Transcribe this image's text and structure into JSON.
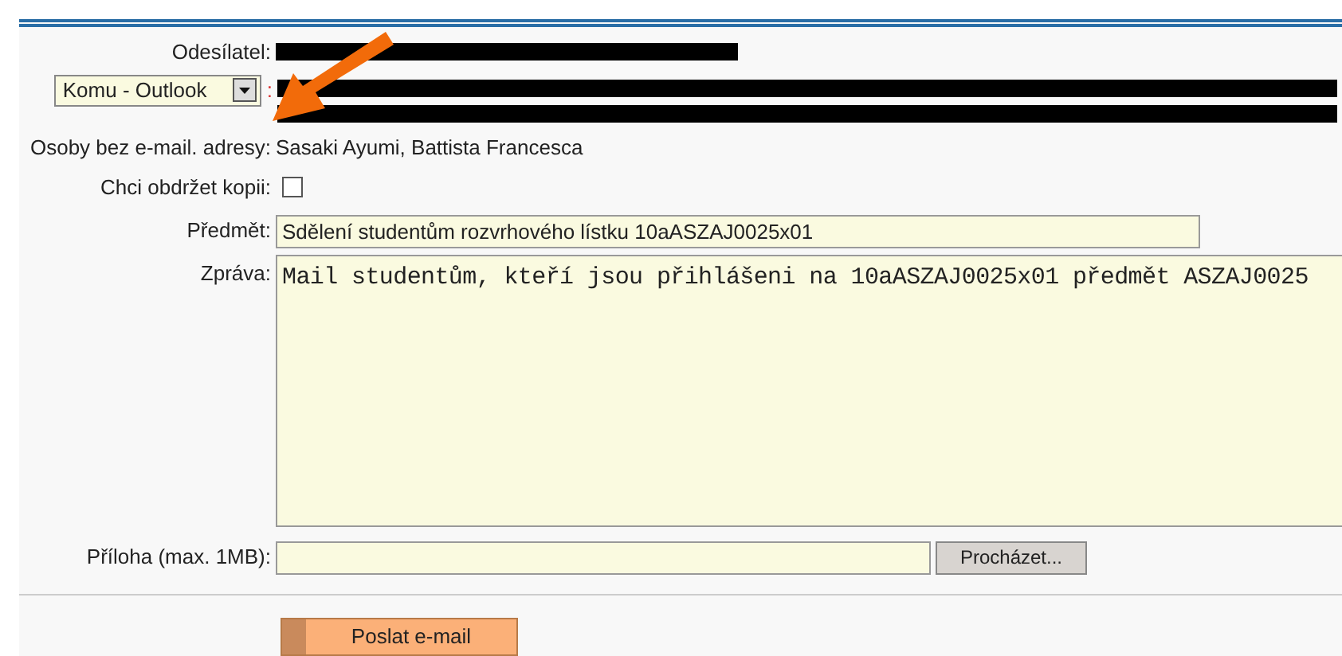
{
  "sender": {
    "label": "Odesílatel:"
  },
  "recipients": {
    "selector": "Komu - Outlook",
    "separator": ":"
  },
  "no_email": {
    "label": "Osoby bez e-mail. adresy:",
    "value": "Sasaki Ayumi, Battista Francesca"
  },
  "copy": {
    "label": "Chci obdržet kopii:",
    "checked": false
  },
  "subject": {
    "label": "Předmět:",
    "value": "Sdělení studentům rozvrhového lístku 10aASZAJ0025x01"
  },
  "message": {
    "label": "Zpráva:",
    "value": "Mail studentům, kteří jsou přihlášeni na 10aASZAJ0025x01 předmět ASZAJ0025"
  },
  "attachment": {
    "label": "Příloha (max. 1MB):",
    "button": "Procházet..."
  },
  "send_button": "Poslat e-mail"
}
